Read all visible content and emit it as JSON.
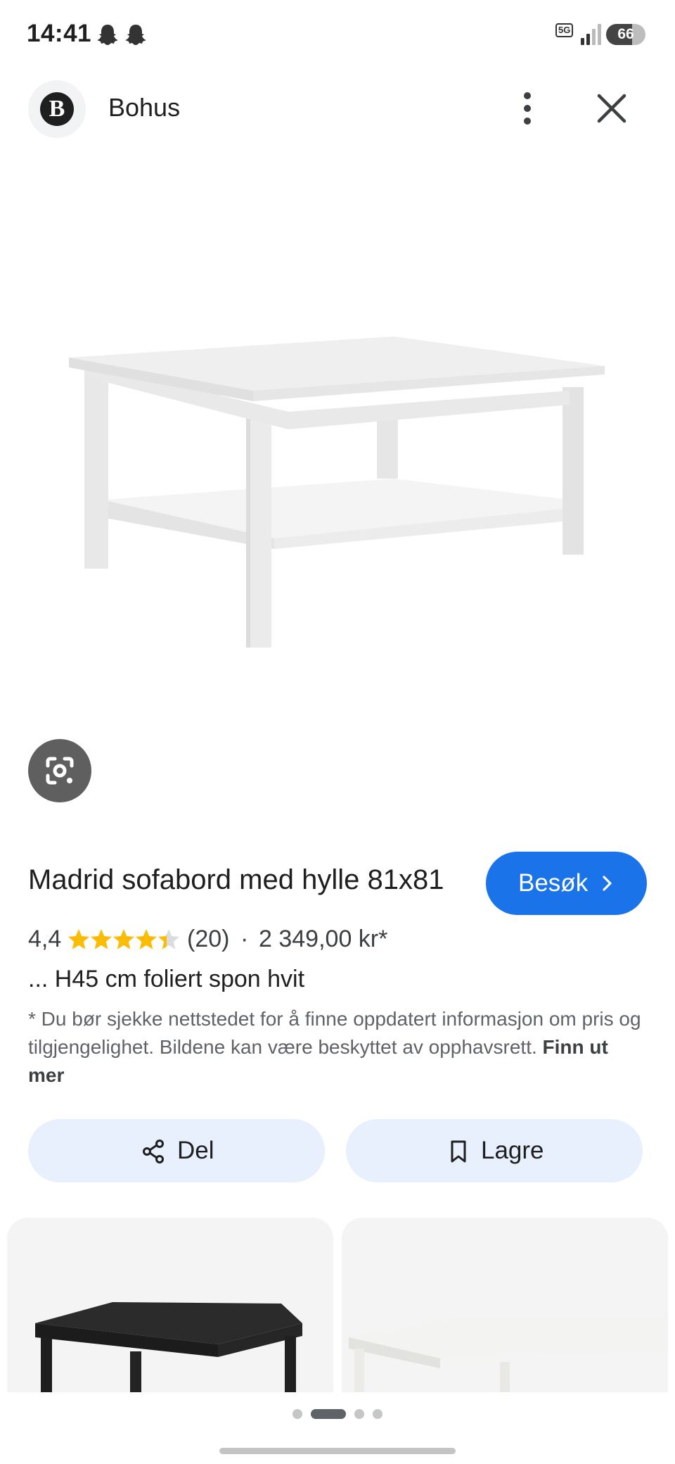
{
  "status_bar": {
    "time": "14:41",
    "notification_icons": [
      "snapchat-ghost-icon",
      "snapchat-ghost-icon"
    ],
    "network": "5G",
    "battery_level": "66"
  },
  "header": {
    "site_logo_letter": "B",
    "site_name": "Bohus",
    "icons": [
      "more-vert-icon",
      "close-icon"
    ]
  },
  "product": {
    "title": "Madrid sofabord med hylle 81x81",
    "visit_label": "Besøk",
    "rating_value": "4,4",
    "rating_stars": 4.4,
    "review_count": "(20)",
    "separator": "·",
    "price": "2 349,00 kr*",
    "description": "... H45 cm foliert spon hvit",
    "disclaimer": "* Du bør sjekke nettstedet for å finne oppdatert informasjon om pris og tilgjengelighet. Bildene kan være beskyttet av opphavsrett.",
    "learn_more": "Finn ut mer"
  },
  "actions": {
    "share_label": "Del",
    "save_label": "Lagre"
  },
  "related": {
    "card_count": 2
  },
  "pagination": {
    "total": 4,
    "active_index": 1
  },
  "colors": {
    "accent": "#1a73e8",
    "action_button_bg": "#e8f0fe",
    "star": "#fbbc04",
    "text_primary": "#1f1f1f",
    "text_secondary": "#5f6368"
  }
}
